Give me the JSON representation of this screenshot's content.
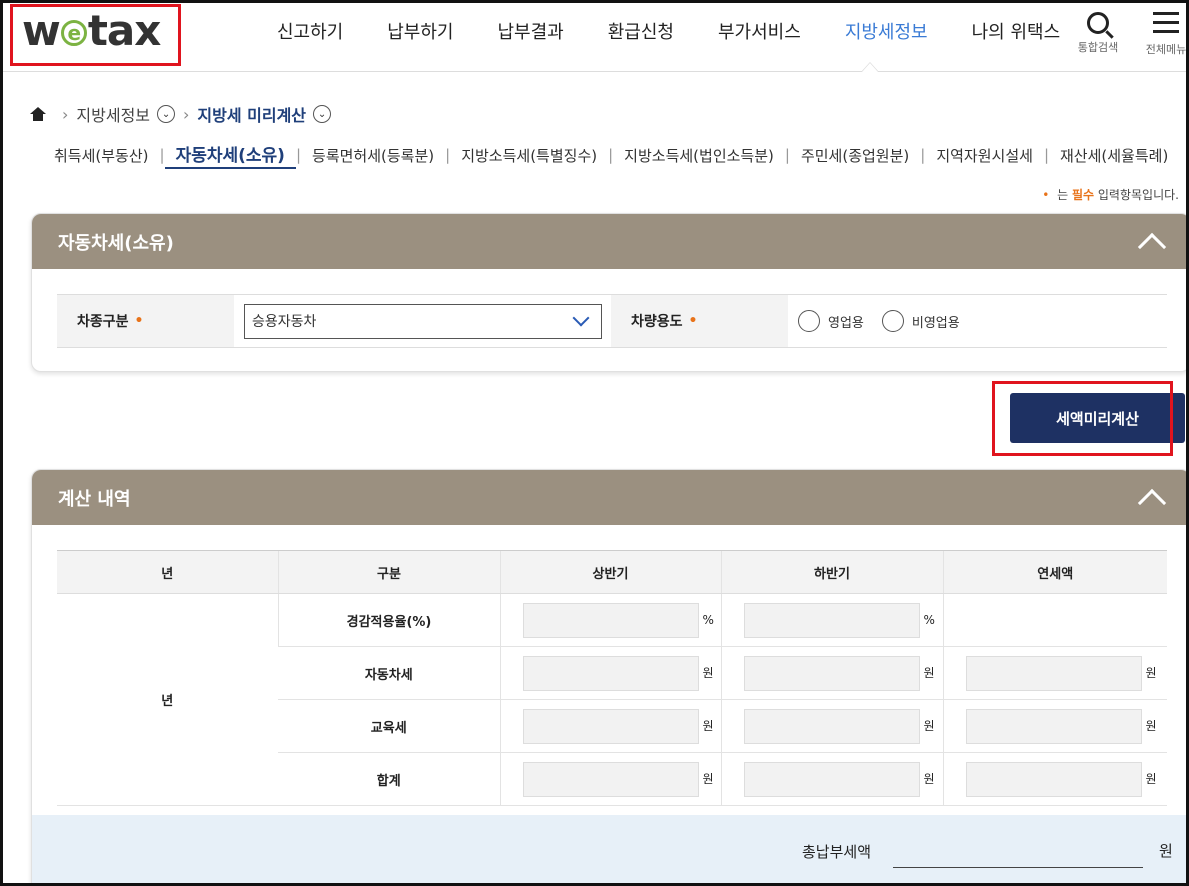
{
  "header": {
    "logo_pre": "w",
    "logo_e": "e",
    "logo_post": "tax",
    "nav": [
      "신고하기",
      "납부하기",
      "납부결과",
      "환급신청",
      "부가서비스",
      "지방세정보",
      "나의 위택스"
    ],
    "active_nav": "지방세정보",
    "search_label": "통합검색",
    "menu_label": "전체메뉴"
  },
  "breadcrumb": {
    "level1": "지방세정보",
    "level2": "지방세 미리계산"
  },
  "subtabs": [
    "취득세(부동산)",
    "자동차세(소유)",
    "등록면허세(등록분)",
    "지방소득세(특별징수)",
    "지방소득세(법인소득분)",
    "주민세(종업원분)",
    "지역자원시설세",
    "재산세(세율특례)"
  ],
  "active_subtab": "자동차세(소유)",
  "required_note": {
    "prefix": "는",
    "highlight": "필수",
    "suffix": "입력항목입니다."
  },
  "form_panel": {
    "title": "자동차세(소유)",
    "vehicle_type_label": "차종구분",
    "vehicle_type_value": "승용자동차",
    "usage_label": "차량용도",
    "usage_options": [
      "영업용",
      "비영업용"
    ]
  },
  "calc_button_label": "세액미리계산",
  "result_panel": {
    "title": "계산 내역",
    "columns": [
      "년",
      "구분",
      "상반기",
      "하반기",
      "연세액"
    ],
    "year_cell": "년",
    "rows": [
      "경감적용율(%)",
      "자동차세",
      "교육세",
      "합계"
    ],
    "percent_unit": "%",
    "won_unit": "원",
    "total_label": "총납부세액",
    "total_unit": "원"
  },
  "colors": {
    "panel_header": "#9b9080",
    "accent_blue": "#3a7bd5",
    "button_navy": "#1e3163",
    "required_orange": "#e8731a",
    "highlight_red": "#e0141e"
  }
}
